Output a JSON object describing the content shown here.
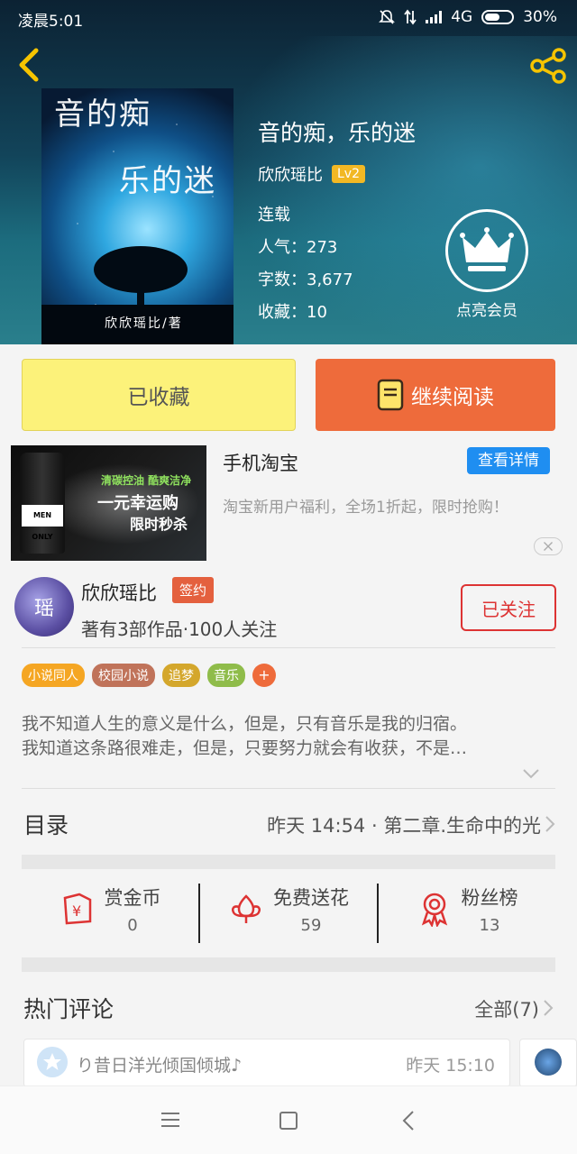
{
  "status_bar": {
    "time": "凌晨5:01",
    "network": "4G",
    "battery": "30%"
  },
  "book": {
    "title": "音的痴，乐的迷",
    "author": "欣欣瑶比",
    "level": "Lv2",
    "status": "连载",
    "popularity": "人气：273",
    "word_count": "字数：3,677",
    "favorites": "收藏：10",
    "cover_title_1": "音的痴",
    "cover_title_2": "乐的迷",
    "cover_author": "欣欣瑶比/著"
  },
  "vip": {
    "label": "点亮会员"
  },
  "actions": {
    "collected": "已收藏",
    "continue_reading": "继续阅读"
  },
  "ad": {
    "title": "手机淘宝",
    "detail_button": "查看详情",
    "desc": "淘宝新用户福利，全场1折起，限时抢购！",
    "img_line1": "清碳控油 酷爽洁净",
    "img_line2": "一元幸运购",
    "img_line3": "限时秒杀",
    "img_brand": "MEN ONLY"
  },
  "author_card": {
    "avatar_char": "瑶",
    "name": "欣欣瑶比",
    "badge": "签约",
    "stats": "著有3部作品·100人关注",
    "follow_button": "已关注"
  },
  "tags": [
    {
      "label": "小说同人",
      "color": "#f5a623"
    },
    {
      "label": "校园小说",
      "color": "#c0735a"
    },
    {
      "label": "追梦",
      "color": "#d4a72c"
    },
    {
      "label": "音乐",
      "color": "#8fbc4a"
    }
  ],
  "tag_add": "+",
  "intro": {
    "line1": "我不知道人生的意义是什么，但是，只有音乐是我的归宿。",
    "line2": "我知道这条路很难走，但是，只要努力就会有收获，不是…"
  },
  "toc": {
    "title": "目录",
    "latest": "昨天 14:54 · 第二章.生命中的光"
  },
  "stats": [
    {
      "name": "赏金币",
      "value": "0",
      "icon": "coin-icon"
    },
    {
      "name": "免费送花",
      "value": "59",
      "icon": "flower-icon"
    },
    {
      "name": "粉丝榜",
      "value": "13",
      "icon": "medal-icon"
    }
  ],
  "comments": {
    "title": "热门评论",
    "all_label": "全部(7)",
    "first_user": "り昔日洋光倾国倾城♪",
    "first_time": "昨天 15:10"
  },
  "colors": {
    "accent_orange": "#ee6b3b",
    "collected_yellow": "#fcf27a",
    "follow_red": "#dd3333",
    "ad_blue": "#1f8ef1"
  }
}
